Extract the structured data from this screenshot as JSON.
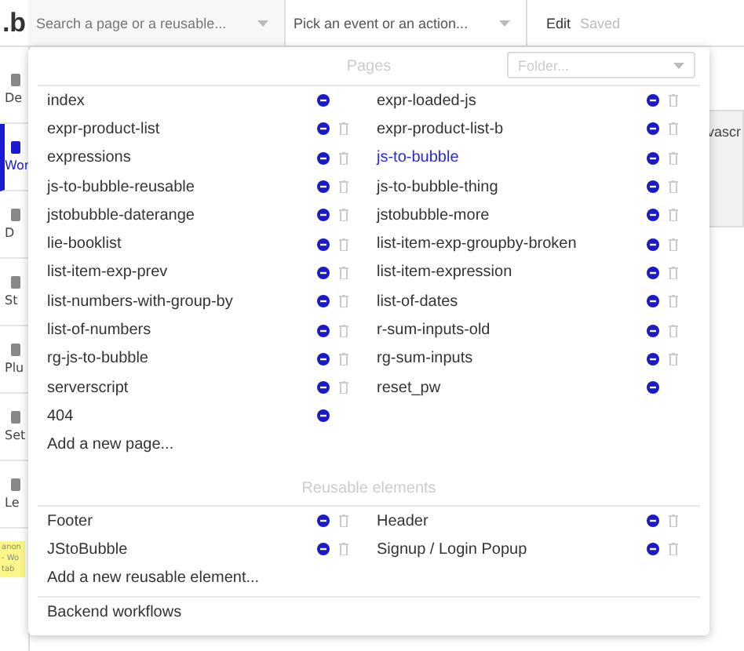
{
  "top_bar": {
    "logo": ".b",
    "page_search": {
      "placeholder": "Search a page or a reusable..."
    },
    "event_picker": {
      "placeholder": "Pick an event or an action..."
    },
    "mode": "Edit",
    "save_status": "Saved"
  },
  "sidebar": {
    "items": [
      {
        "label": "De",
        "selected": false
      },
      {
        "label": "Wor",
        "selected": true
      },
      {
        "label": "D",
        "selected": false
      },
      {
        "label": "St",
        "selected": false
      },
      {
        "label": "Plu",
        "selected": false
      },
      {
        "label": "Set",
        "selected": false
      },
      {
        "label": "Le",
        "selected": false
      }
    ],
    "note": "anon - Wo tab"
  },
  "background": {
    "text": "vascr"
  },
  "page_menu": {
    "pages_header": "Pages",
    "folder": {
      "placeholder": "Folder..."
    },
    "pages": [
      {
        "name": "index",
        "selected": false,
        "deletable": false
      },
      {
        "name": "expr-loaded-js",
        "selected": false,
        "deletable": true
      },
      {
        "name": "expr-product-list",
        "selected": false,
        "deletable": true
      },
      {
        "name": "expr-product-list-b",
        "selected": false,
        "deletable": true
      },
      {
        "name": "expressions",
        "selected": false,
        "deletable": true
      },
      {
        "name": "js-to-bubble",
        "selected": true,
        "deletable": true
      },
      {
        "name": "js-to-bubble-reusable",
        "selected": false,
        "deletable": true
      },
      {
        "name": "js-to-bubble-thing",
        "selected": false,
        "deletable": true
      },
      {
        "name": "jstobubble-daterange",
        "selected": false,
        "deletable": true
      },
      {
        "name": "jstobubble-more",
        "selected": false,
        "deletable": true
      },
      {
        "name": "lie-booklist",
        "selected": false,
        "deletable": true
      },
      {
        "name": "list-item-exp-groupby-broken",
        "selected": false,
        "deletable": true
      },
      {
        "name": "list-item-exp-prev",
        "selected": false,
        "deletable": true
      },
      {
        "name": "list-item-expression",
        "selected": false,
        "deletable": true
      },
      {
        "name": "list-numbers-with-group-by",
        "selected": false,
        "deletable": true
      },
      {
        "name": "list-of-dates",
        "selected": false,
        "deletable": true
      },
      {
        "name": "list-of-numbers",
        "selected": false,
        "deletable": true
      },
      {
        "name": "r-sum-inputs-old",
        "selected": false,
        "deletable": true
      },
      {
        "name": "rg-js-to-bubble",
        "selected": false,
        "deletable": true
      },
      {
        "name": "rg-sum-inputs",
        "selected": false,
        "deletable": true
      },
      {
        "name": "serverscript",
        "selected": false,
        "deletable": true
      },
      {
        "name": "reset_pw",
        "selected": false,
        "deletable": false
      },
      {
        "name": "404",
        "selected": false,
        "deletable": false
      }
    ],
    "add_page": "Add a new page...",
    "reusables_header": "Reusable elements",
    "reusables": [
      {
        "name": "Footer",
        "selected": false,
        "deletable": true
      },
      {
        "name": "Header",
        "selected": false,
        "deletable": true
      },
      {
        "name": "JStoBubble",
        "selected": false,
        "deletable": true
      },
      {
        "name": "Signup / Login Popup",
        "selected": false,
        "deletable": true
      }
    ],
    "add_reusable": "Add a new reusable element...",
    "backend": "Backend workflows"
  }
}
